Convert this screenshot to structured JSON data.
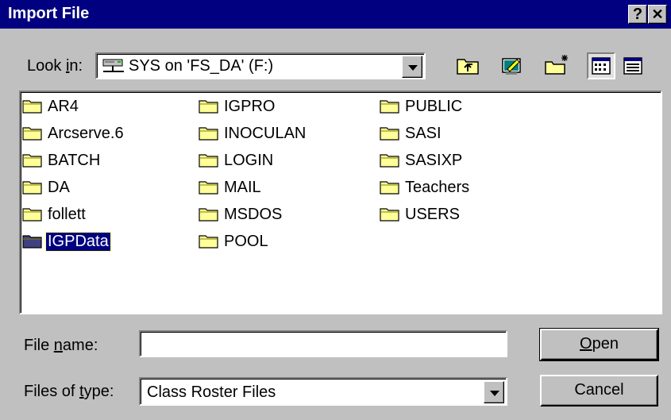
{
  "window": {
    "title": "Import File",
    "help_glyph": "?",
    "close_glyph": "✕"
  },
  "look_in": {
    "label_pre": "Look ",
    "label_key": "i",
    "label_post": "n:",
    "value": "SYS on 'FS_DA' (F:)",
    "icon": "network-drive-icon"
  },
  "toolbar": [
    {
      "name": "up-one-level-button",
      "icon": "up-folder-icon"
    },
    {
      "name": "desktop-button",
      "icon": "desktop-icon"
    },
    {
      "name": "create-new-folder-button",
      "icon": "new-folder-icon"
    },
    {
      "name": "list-view-button",
      "icon": "list-view-icon",
      "pressed": true
    },
    {
      "name": "details-view-button",
      "icon": "details-view-icon"
    }
  ],
  "files": {
    "columns": [
      [
        "AR4",
        "Arcserve.6",
        "BATCH",
        "DA",
        "follett",
        "IGPData"
      ],
      [
        "IGPRO",
        "INOCULAN",
        "LOGIN",
        "MAIL",
        "MSDOS",
        "POOL"
      ],
      [
        "PUBLIC",
        "SASI",
        "SASIXP",
        "Teachers",
        "USERS"
      ]
    ],
    "selected": "IGPData"
  },
  "file_name": {
    "label_pre": "File ",
    "label_key": "n",
    "label_post": "ame:",
    "value": ""
  },
  "file_type": {
    "label_pre": "Files of ",
    "label_key": "t",
    "label_post": "ype:",
    "value": "Class Roster Files"
  },
  "buttons": {
    "open_key": "O",
    "open_rest": "pen",
    "cancel": "Cancel"
  },
  "colors": {
    "face": "#c0c0c0",
    "title_bar": "#000080",
    "folder": "#ffff99",
    "selection": "#000080"
  }
}
